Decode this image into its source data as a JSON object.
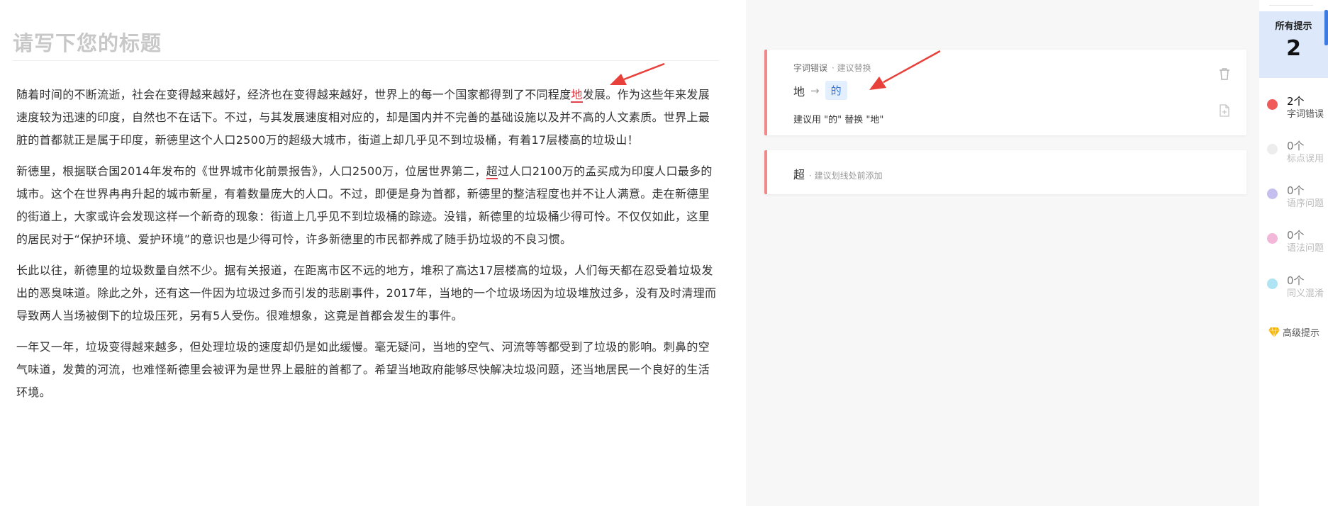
{
  "editor": {
    "title_placeholder": "请写下您的标题",
    "paragraphs": [
      [
        {
          "text": "随着时间的不断流逝，社会在变得越来越好，经济也在变得越来越好，世界上的每一个国家都得到了不同程度"
        },
        {
          "text": "地",
          "flag": "strong"
        },
        {
          "text": "发展。作为这些年来发展速度较为迅速的印度，自然也不在话下。不过，与其发展速度相对应的，却是国内并不完善的基础设施以及并不高的人文素质。世界上最脏的首都就正是属于印度，新德里这个人口2500万的超级大城市，街道上却几乎见不到垃圾桶，有着17层楼高的垃圾山！"
        }
      ],
      [
        {
          "text": "新德里，根据联合国2014年发布的《世界城市化前景报告》，人口2500万，位居世界第二，"
        },
        {
          "text": "超",
          "flag": "light"
        },
        {
          "text": "过人口2100万的孟买成为印度人口最多的城市。这个在世界冉冉升起的城市新星，有着数量庞大的人口。不过，即便是身为首都，新德里的整洁程度也并不让人满意。走在新德里的街道上，大家或许会发现这样一个新奇的现象：街道上几乎见不到垃圾桶的踪迹。没错，新德里的垃圾桶少得可怜。不仅仅如此，这里的居民对于“保护环境、爱护环境”的意识也是少得可怜，许多新德里的市民都养成了随手扔垃圾的不良习惯。"
        }
      ],
      [
        {
          "text": "长此以往，新德里的垃圾数量自然不少。据有关报道，在距离市区不远的地方，堆积了高达17层楼高的垃圾，人们每天都在忍受着垃圾发出的恶臭味道。除此之外，还有这一件因为垃圾过多而引发的悲剧事件，2017年，当地的一个垃圾场因为垃圾堆放过多，没有及时清理而导致两人当场被倒下的垃圾压死，另有5人受伤。很难想象，这竟是首都会发生的事件。"
        }
      ],
      [
        {
          "text": "一年又一年，垃圾变得越来越多，但处理垃圾的速度却仍是如此缓慢。毫无疑问，当地的空气、河流等等都受到了垃圾的影响。刺鼻的空气味道，发黄的河流，也难怪新德里会被评为是世界上最脏的首都了。希望当地政府能够尽快解决垃圾问题，还当地居民一个良好的生活环境。"
        }
      ]
    ]
  },
  "panel": {
    "card1": {
      "category": "字词错误",
      "action": "· 建议替换",
      "original": "地",
      "arrow": "→",
      "replacement": "的",
      "advice": "建议用 \"的\" 替换 \"地\""
    },
    "card2": {
      "word": "超",
      "hint": "· 建议划线处前添加"
    }
  },
  "rail": {
    "total_label": "所有提示",
    "total_count": "2",
    "stats": [
      {
        "count": "2个",
        "name": "字词错误",
        "color": "#ef5b5b",
        "active": true
      },
      {
        "count": "0个",
        "name": "标点误用",
        "color": "#dcdcdc",
        "active": false
      },
      {
        "count": "0个",
        "name": "语序问题",
        "color": "#8a7fe0",
        "active": false
      },
      {
        "count": "0个",
        "name": "语法问题",
        "color": "#e86fb6",
        "active": false
      },
      {
        "count": "0个",
        "name": "同义混淆",
        "color": "#5ec9e8",
        "active": false
      }
    ],
    "premium_label": "高级提示",
    "premium_color": "#f5b400"
  },
  "annotation_color": "#e8403a"
}
